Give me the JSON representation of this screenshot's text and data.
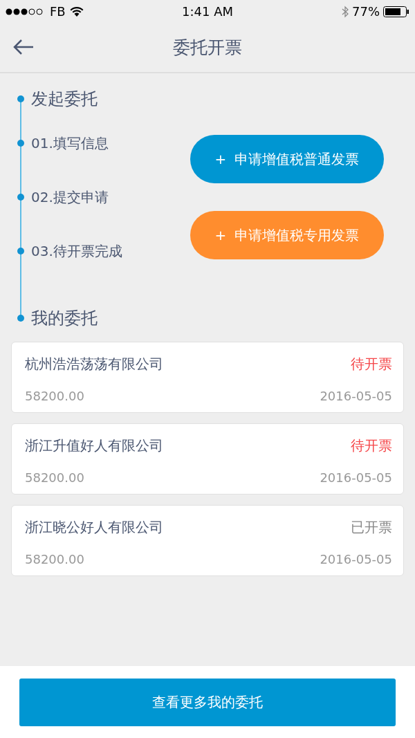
{
  "status_bar": {
    "carrier": "FB",
    "time": "1:41 AM",
    "battery": "77%"
  },
  "nav": {
    "title": "委托开票"
  },
  "flow": {
    "start_heading": "发起委托",
    "steps": [
      "01.填写信息",
      "02.提交申请",
      "03.待开票完成"
    ],
    "actions": [
      {
        "kind": "blue",
        "icon": "+",
        "label": "申请增值税普通发票"
      },
      {
        "kind": "orange",
        "icon": "+",
        "label": "申请增值税专用发票"
      }
    ],
    "end_heading": "我的委托"
  },
  "orders": [
    {
      "company": "杭州浩浩荡荡有限公司",
      "status": "待开票",
      "kind": "pending",
      "amount": "58200.00",
      "date": "2016-05-05"
    },
    {
      "company": "浙江升值好人有限公司",
      "status": "待开票",
      "kind": "pending",
      "amount": "58200.00",
      "date": "2016-05-05"
    },
    {
      "company": "浙江晓公好人有限公司",
      "status": "已开票",
      "kind": "done",
      "amount": "58200.00",
      "date": "2016-05-05"
    }
  ],
  "more_button": "查看更多我的委托"
}
